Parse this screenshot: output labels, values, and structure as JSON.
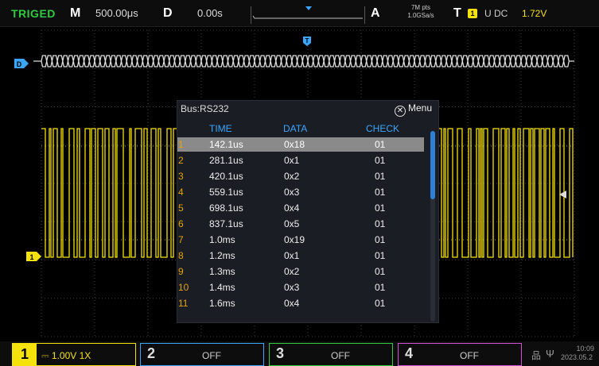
{
  "top_bar": {
    "trigger_status": "TRIGED",
    "horizontal_key": "M",
    "timebase": "500.00μs",
    "delay_key": "D",
    "delay": "0.00s",
    "acquire_key": "A",
    "memory_depth": "7M pts",
    "sample_rate": "1.0GSa/s",
    "trigger_key": "T",
    "trigger_channel": "1",
    "trigger_mode": "U DC",
    "trigger_level": "1.72V"
  },
  "scope": {
    "bus_marker": "D",
    "ch1_marker": "1",
    "trigger_marker": "T"
  },
  "bus_dialog": {
    "title": "Bus:RS232",
    "menu_label": "Menu",
    "columns": [
      "TIME",
      "DATA",
      "CHECK"
    ],
    "rows": [
      {
        "index": "1",
        "time": "142.1us",
        "data": "0x18",
        "check": "01",
        "selected": true
      },
      {
        "index": "2",
        "time": "281.1us",
        "data": "0x1",
        "check": "01"
      },
      {
        "index": "3",
        "time": "420.1us",
        "data": "0x2",
        "check": "01"
      },
      {
        "index": "4",
        "time": "559.1us",
        "data": "0x3",
        "check": "01"
      },
      {
        "index": "5",
        "time": "698.1us",
        "data": "0x4",
        "check": "01"
      },
      {
        "index": "6",
        "time": "837.1us",
        "data": "0x5",
        "check": "01"
      },
      {
        "index": "7",
        "time": "1.0ms",
        "data": "0x19",
        "check": "01"
      },
      {
        "index": "8",
        "time": "1.2ms",
        "data": "0x1",
        "check": "01"
      },
      {
        "index": "9",
        "time": "1.3ms",
        "data": "0x2",
        "check": "01"
      },
      {
        "index": "10",
        "time": "1.4ms",
        "data": "0x3",
        "check": "01"
      },
      {
        "index": "11",
        "time": "1.6ms",
        "data": "0x4",
        "check": "01"
      }
    ]
  },
  "bottom_bar": {
    "ch1": {
      "number": "1",
      "setting": "1.00V 1X"
    },
    "ch2": {
      "number": "2",
      "setting": "OFF"
    },
    "ch3": {
      "number": "3",
      "setting": "OFF"
    },
    "ch4": {
      "number": "4",
      "setting": "OFF"
    },
    "time": "10:09",
    "date": "2023.05.2"
  },
  "colors": {
    "ch1": "#f5e20b",
    "ch2": "#3aa6ff",
    "ch3": "#2ecc40",
    "ch4": "#d24fd6",
    "accent": "#3aa6ff",
    "trigger_status": "#2ecc40"
  }
}
